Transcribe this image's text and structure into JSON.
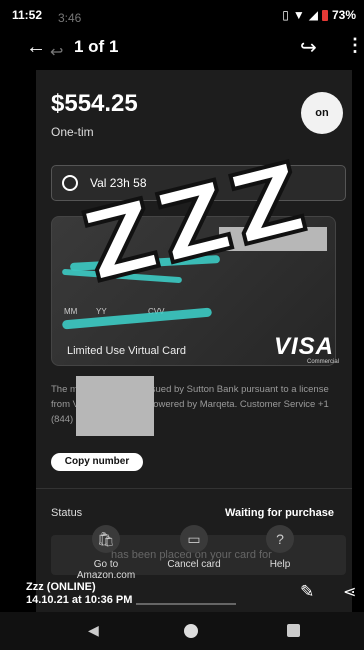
{
  "status_bar": {
    "time": "11:52",
    "photo_time": "3:46",
    "battery": "73%"
  },
  "viewer": {
    "counter": "1 of 1"
  },
  "card_screen": {
    "amount": "$554.25",
    "subtitle": "One-tim",
    "logo_text": "on",
    "valid_text": "Val        23h 58",
    "card_mm": "MM",
    "card_yy": "YY",
    "card_cvv": "CVV",
    "card_label": "Limited Use Virtual Card",
    "visa": "VISA",
    "visa_sub": "Commercial",
    "legal": "The                               mmercial Card is issued by Sutton Bank                          pursuant to a license from Visa U.S.A Inc.                            is powered by Marqeta.    Customer Service +1 (844) 552-7621",
    "copy_button": "Copy number",
    "status_label": "Status",
    "status_value": "Waiting for purchase",
    "notice": "has been placed on your card for"
  },
  "bottom_nav": [
    {
      "label": "Go to",
      "label2": "Amazon.com",
      "icon": "bag-icon"
    },
    {
      "label": "Cancel card",
      "icon": "card-icon"
    },
    {
      "label": "Help",
      "icon": "help-icon"
    }
  ],
  "overlay": {
    "text": "ZZZ"
  },
  "caption": {
    "name": "Zzz (ONLINE)",
    "timestamp": "14.10.21 at 10:36 PM"
  }
}
